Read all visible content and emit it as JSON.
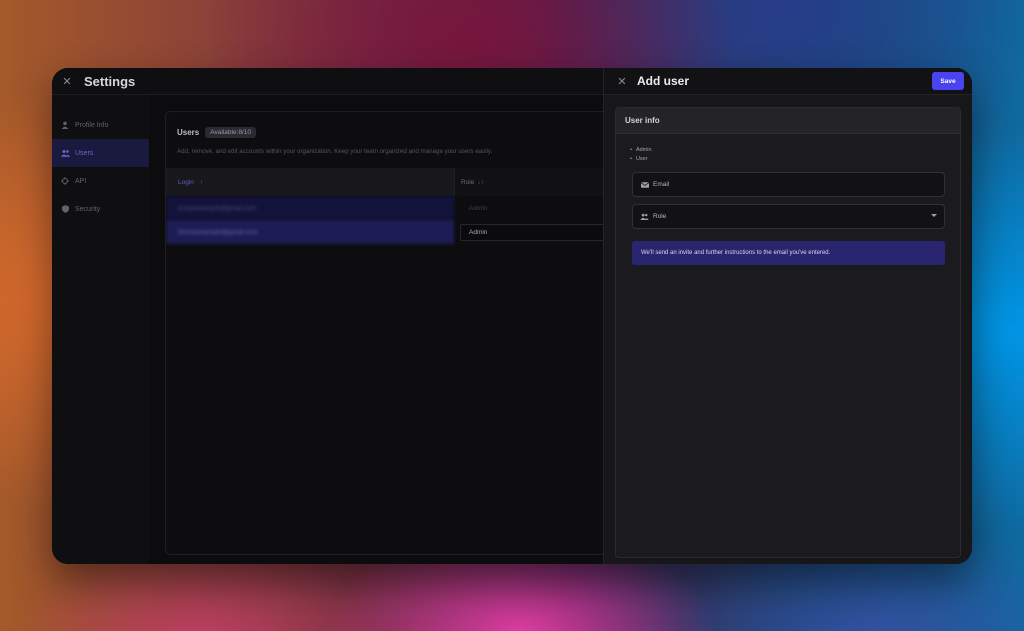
{
  "settings": {
    "title": "Settings",
    "close_icon": "close-icon",
    "sidebar": {
      "items": [
        {
          "label": "Profile Info",
          "icon": "user-icon",
          "active": false
        },
        {
          "label": "Users",
          "icon": "users-icon",
          "active": true
        },
        {
          "label": "API",
          "icon": "api-icon",
          "active": false
        },
        {
          "label": "Security",
          "icon": "shield-icon",
          "active": false
        }
      ]
    },
    "users": {
      "title": "Users",
      "badge": "Available:8/10",
      "description": "Add, remove, and edit accounts within your organization. Keep your team organized and manage your users easily.",
      "columns": {
        "login": "Login",
        "login_sort": "↑",
        "role": "Role",
        "role_sort": "↓↑"
      },
      "rows": [
        {
          "login": "emaclexample@gmail.com",
          "role": "Admin"
        },
        {
          "login": "Dominexample@gmail.com",
          "role": "Admin"
        }
      ]
    }
  },
  "add_user": {
    "title": "Add user",
    "save_label": "Save",
    "card_title": "User info",
    "role_options": [
      "Admin",
      "User"
    ],
    "email_placeholder": "Email",
    "role_placeholder": "Role",
    "notice": "We'll send an invite and further instructions to the email you've entered."
  },
  "colors": {
    "accent": "#4a44f0",
    "active_nav_bg": "#1a1a3e",
    "notice_bg": "#29266f"
  }
}
